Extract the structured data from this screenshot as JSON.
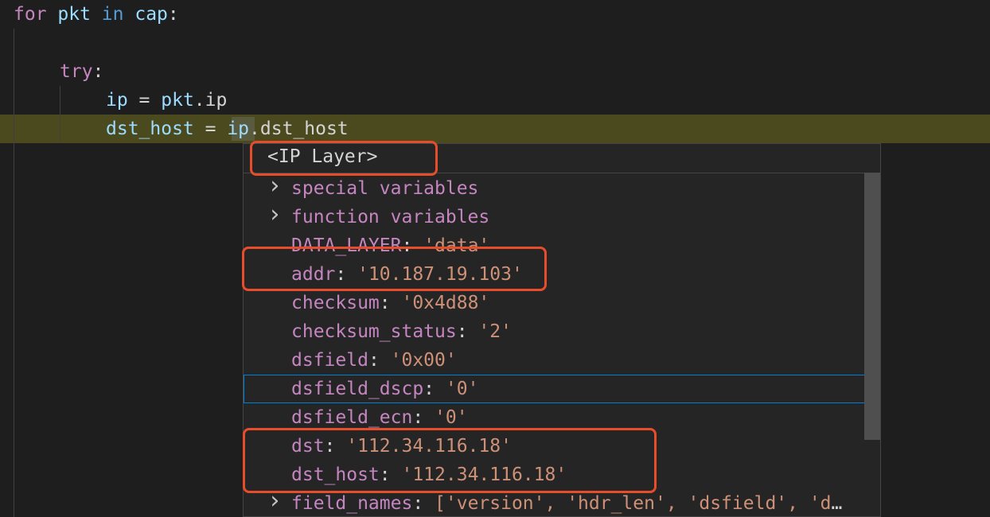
{
  "editor": {
    "lines": [
      {
        "tokens": [
          {
            "t": "for",
            "c": "kw"
          },
          {
            "t": " pkt ",
            "c": "var"
          },
          {
            "t": "in",
            "c": "kw2"
          },
          {
            "t": " cap",
            "c": "var"
          },
          {
            "t": ":",
            "c": "plain"
          }
        ]
      },
      {
        "tokens": [
          {
            "t": "try",
            "c": "kw"
          },
          {
            "t": ":",
            "c": "plain"
          }
        ]
      },
      {
        "tokens": [
          {
            "t": "ip",
            "c": "var"
          },
          {
            "t": " = ",
            "c": "plain"
          },
          {
            "t": "pkt",
            "c": "var"
          },
          {
            "t": ".ip",
            "c": "plain"
          }
        ]
      },
      {
        "tokens": [
          {
            "t": "dst_host",
            "c": "var"
          },
          {
            "t": " = ",
            "c": "plain"
          },
          {
            "t": "ip",
            "c": "var"
          },
          {
            "t": ".dst_host",
            "c": "plain"
          }
        ]
      }
    ]
  },
  "hover": {
    "title": "<IP Layer>",
    "items": [
      {
        "expandable": true,
        "key": "special variables",
        "value": ""
      },
      {
        "expandable": true,
        "key": "function variables",
        "value": ""
      },
      {
        "expandable": false,
        "key": "DATA_LAYER",
        "value": "'data'"
      },
      {
        "expandable": false,
        "key": "addr",
        "value": "'10.187.19.103'"
      },
      {
        "expandable": false,
        "key": "checksum",
        "value": "'0x4d88'"
      },
      {
        "expandable": false,
        "key": "checksum_status",
        "value": "'2'"
      },
      {
        "expandable": false,
        "key": "dsfield",
        "value": "'0x00'"
      },
      {
        "expandable": false,
        "key": "dsfield_dscp",
        "value": "'0'",
        "focused": true
      },
      {
        "expandable": false,
        "key": "dsfield_ecn",
        "value": "'0'"
      },
      {
        "expandable": false,
        "key": "dst",
        "value": "'112.34.116.18'"
      },
      {
        "expandable": false,
        "key": "dst_host",
        "value": "'112.34.116.18'"
      },
      {
        "expandable": true,
        "key": "field_names",
        "value": "['version', 'hdr_len', 'dsfield', 'dsfield_dscp', 'dsfield_ecn']"
      }
    ]
  },
  "icons": {
    "chevron": "chevron-right-icon"
  },
  "colors": {
    "annotation": "#e84d2b",
    "line_highlight": "#4b4a1f",
    "focus_border": "#007fd4"
  }
}
